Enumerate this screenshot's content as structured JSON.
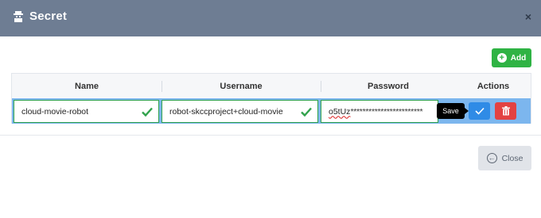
{
  "dialog": {
    "title": "Secret",
    "close_glyph": "×",
    "title_icon": "secret-icon"
  },
  "toolbar": {
    "add_label": "Add",
    "add_icon": "plus-circle-icon"
  },
  "table": {
    "headers": {
      "name": "Name",
      "username": "Username",
      "password": "Password",
      "actions": "Actions"
    },
    "row": {
      "name": "cloud-movie-robot",
      "username": "robot-skccproject+cloud-movie",
      "password_visible": "o5tUz",
      "password_masked": "************************",
      "row_selected": true
    },
    "tooltip": "Save"
  },
  "footer": {
    "close_label": "Close",
    "close_icon": "circle-arrow-left-icon"
  },
  "colors": {
    "header_bg": "#6e7d93",
    "add_green": "#2fb344",
    "row_highlight": "#7cb6ee",
    "save_blue": "#2f8be6",
    "delete_red": "#e34242",
    "valid_green": "#31a24c"
  }
}
